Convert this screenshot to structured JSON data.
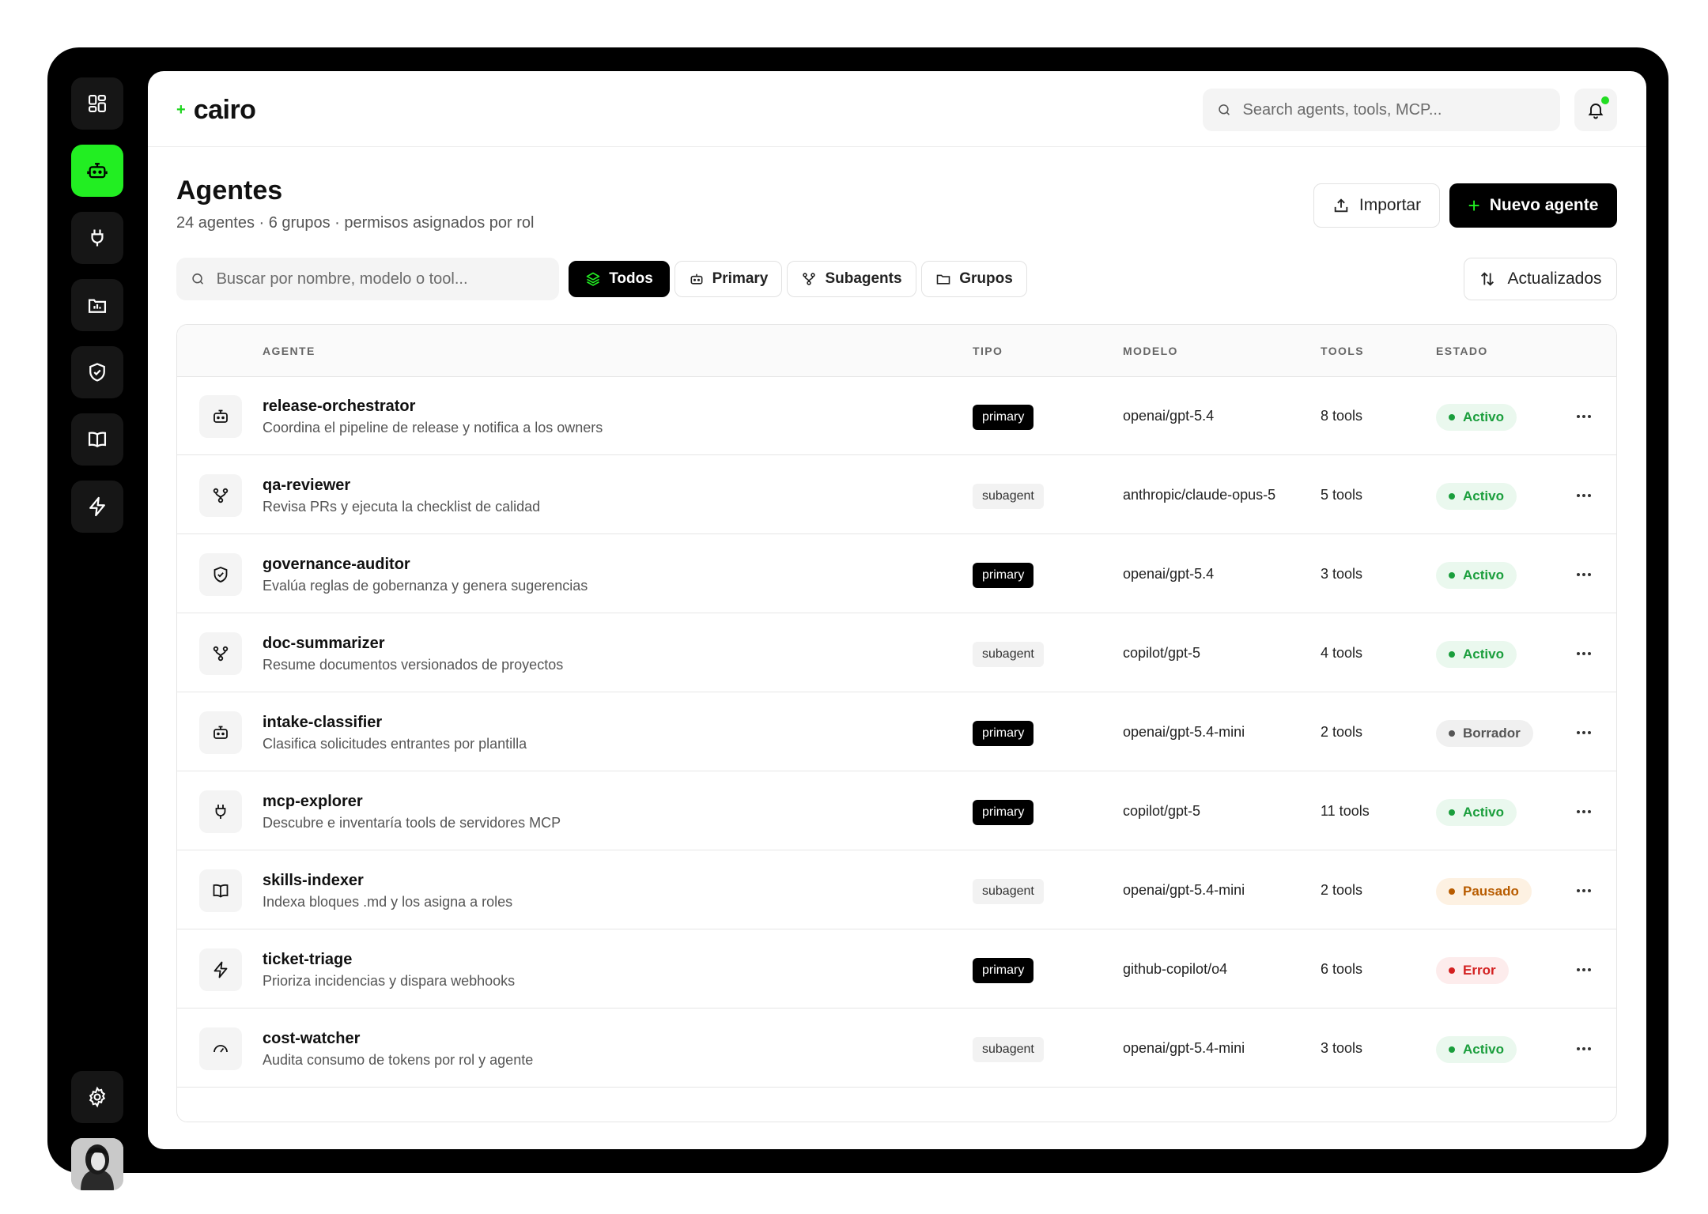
{
  "brand": {
    "name": "cairo"
  },
  "topbar": {
    "search_placeholder": "Search agents, tools, MCP..."
  },
  "page": {
    "title": "Agentes",
    "subtitle": "24 agentes · 6 grupos · permisos asignados por rol"
  },
  "actions": {
    "import_label": "Importar",
    "new_label": "Nuevo agente",
    "sort_label": "Actualizados"
  },
  "filters": {
    "search_placeholder": "Buscar por nombre, modelo o tool...",
    "chips": [
      {
        "label": "Todos",
        "icon": "layers-icon"
      },
      {
        "label": "Primary",
        "icon": "robot-icon"
      },
      {
        "label": "Subagents",
        "icon": "branch-icon"
      },
      {
        "label": "Grupos",
        "icon": "folder-icon"
      }
    ]
  },
  "sidebar": {
    "items": [
      {
        "icon": "dashboard-icon"
      },
      {
        "icon": "robot-icon",
        "active": true
      },
      {
        "icon": "plug-icon"
      },
      {
        "icon": "chart-icon"
      },
      {
        "icon": "shield-icon"
      },
      {
        "icon": "book-icon"
      },
      {
        "icon": "bolt-icon"
      },
      {
        "icon": "gear-icon"
      }
    ]
  },
  "colors": {
    "accent": "#22ee22",
    "active": "#1a9e3c",
    "draft": "#555555",
    "paused": "#b85c00",
    "error": "#d32020"
  },
  "table": {
    "headers": {
      "agent": "AGENTE",
      "type": "TIPO",
      "model": "MODELO",
      "tools": "TOOLS",
      "status": "ESTADO"
    },
    "rows": [
      {
        "name": "release-orchestrator",
        "desc": "Coordina el pipeline de release y notifica a los owners",
        "type": "primary",
        "model": "openai/gpt-5.4",
        "tools": "8 tools",
        "status": "Activo",
        "icon": "robot-icon"
      },
      {
        "name": "qa-reviewer",
        "desc": "Revisa PRs y ejecuta la checklist de calidad",
        "type": "subagent",
        "model": "anthropic/claude-opus-5",
        "tools": "5 tools",
        "status": "Activo",
        "icon": "branch-icon"
      },
      {
        "name": "governance-auditor",
        "desc": "Evalúa reglas de gobernanza y genera sugerencias",
        "type": "primary",
        "model": "openai/gpt-5.4",
        "tools": "3 tools",
        "status": "Activo",
        "icon": "shield-icon"
      },
      {
        "name": "doc-summarizer",
        "desc": "Resume documentos versionados de proyectos",
        "type": "subagent",
        "model": "copilot/gpt-5",
        "tools": "4 tools",
        "status": "Activo",
        "icon": "branch-icon"
      },
      {
        "name": "intake-classifier",
        "desc": "Clasifica solicitudes entrantes por plantilla",
        "type": "primary",
        "model": "openai/gpt-5.4-mini",
        "tools": "2 tools",
        "status": "Borrador",
        "icon": "robot-icon"
      },
      {
        "name": "mcp-explorer",
        "desc": "Descubre e inventaría tools de servidores MCP",
        "type": "primary",
        "model": "copilot/gpt-5",
        "tools": "11 tools",
        "status": "Activo",
        "icon": "plug-icon"
      },
      {
        "name": "skills-indexer",
        "desc": "Indexa bloques .md y los asigna a roles",
        "type": "subagent",
        "model": "openai/gpt-5.4-mini",
        "tools": "2 tools",
        "status": "Pausado",
        "icon": "book-icon"
      },
      {
        "name": "ticket-triage",
        "desc": "Prioriza incidencias y dispara webhooks",
        "type": "primary",
        "model": "github-copilot/o4",
        "tools": "6 tools",
        "status": "Error",
        "icon": "bolt-icon"
      },
      {
        "name": "cost-watcher",
        "desc": "Audita consumo de tokens por rol y agente",
        "type": "subagent",
        "model": "openai/gpt-5.4-mini",
        "tools": "3 tools",
        "status": "Activo",
        "icon": "gauge-icon"
      }
    ]
  }
}
